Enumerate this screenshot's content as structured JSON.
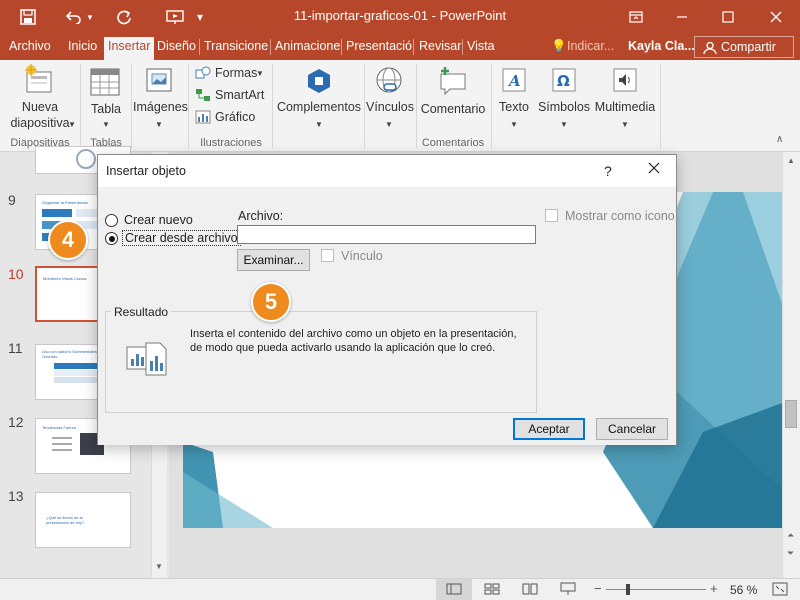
{
  "app": {
    "file_title": "11-importar-graficos-01 - PowerPoint",
    "user": "Kayla Cla...",
    "share_label": "Compartir",
    "tell_me": "Indicar...",
    "accent": "#b7472a"
  },
  "tabs": [
    "Archivo",
    "Inicio",
    "Insertar",
    "Diseño",
    "Transicione",
    "Animacione",
    "Presentació",
    "Revisar",
    "Vista"
  ],
  "active_tab": "Insertar",
  "ribbon": {
    "new_slide_line1": "Nueva",
    "new_slide_line2": "diapositiva",
    "table": "Tabla",
    "images": "Imágenes",
    "shapes": "Formas",
    "smartart": "SmartArt",
    "chart": "Gráfico",
    "addins": "Complementos",
    "links": "Vínculos",
    "comment": "Comentario",
    "text": "Texto",
    "symbols": "Símbolos",
    "multimedia": "Multimedia",
    "groups": {
      "slides": "Diapositivas",
      "tables": "Tablas",
      "illustrations": "Ilustraciones",
      "comments": "Comentarios"
    }
  },
  "slides": {
    "numbers": [
      "9",
      "10",
      "11",
      "12",
      "13"
    ],
    "titles": {
      "s9": "Organizar la Presentación",
      "s10": "Monitoreo Vistas Curvas",
      "s11": "Uso con sabor/o Sortimentales Ocurado",
      "s12": "Tendencias Fuerza",
      "s13": "¿Qué se llevan de la presentación de hoy?"
    }
  },
  "dialog": {
    "title": "Insertar objeto",
    "help": "?",
    "radio_new": "Crear nuevo",
    "radio_from_file": "Crear desde archivo",
    "file_label": "Archivo:",
    "file_value": "",
    "browse_button": "Examinar...",
    "link_label": "Vínculo",
    "show_icon_label": "Mostrar como icono",
    "result_label": "Resultado",
    "result_text": "Inserta el contenido del archivo como un objeto en la presentación, de modo que pueda activarlo usando la aplicación que lo creó.",
    "ok": "Aceptar",
    "cancel": "Cancelar"
  },
  "callouts": {
    "step4": "4",
    "step5": "5",
    "color": "#ef8a1e"
  },
  "status": {
    "zoom": "56 %"
  }
}
